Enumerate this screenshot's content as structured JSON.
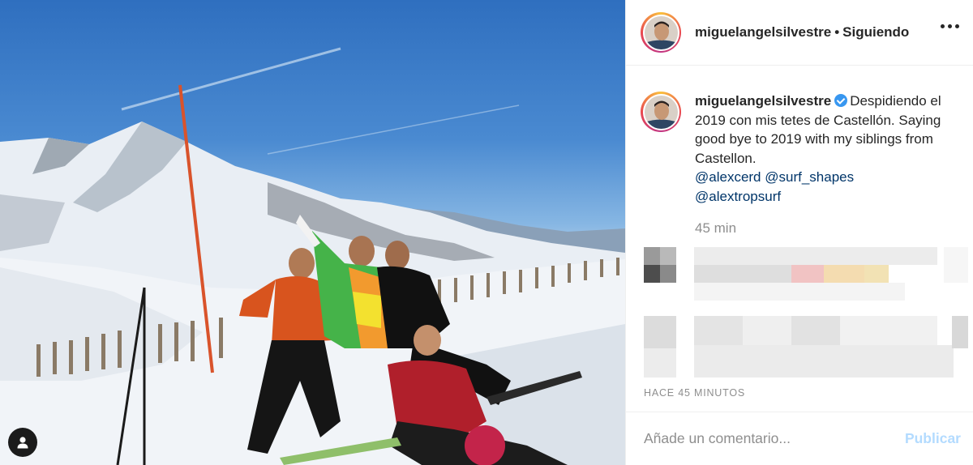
{
  "post": {
    "username": "miguelangelsilvestre",
    "follow_state": "Siguiendo",
    "separator": "•",
    "verified": true,
    "caption_text": "Despidiendo el 2019 con mis tetes de Castellón. Saying good bye to 2019 with my siblings from Castellon.",
    "mentions": [
      "@alexcerd",
      "@surf_shapes",
      "@alextropsurf"
    ],
    "caption_age": "45 min",
    "timestamp": "HACE 45 MINUTOS"
  },
  "comment": {
    "placeholder": "Añade un comentario...",
    "publish_label": "Publicar"
  },
  "icons": {
    "more": "more-options-icon",
    "user_tag": "user-tag-icon",
    "verified": "verified-badge-icon"
  },
  "colors": {
    "accent": "#3897f0",
    "mention": "#003569",
    "muted": "#8e8e8e",
    "publish_disabled": "#b3dbff"
  }
}
